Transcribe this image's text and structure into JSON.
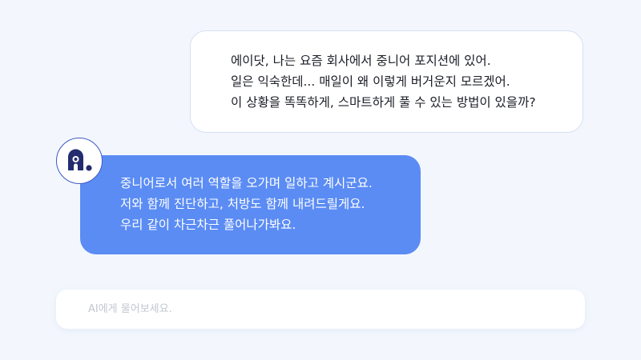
{
  "conversation": {
    "user_message": {
      "lines": [
        "에이닷, 나는 요즘 회사에서 중니어 포지션에 있어.",
        "일은 익숙한데... 매일이 왜 이렇게 버거운지 모르겠어.",
        "이 상황을 똑똑하게, 스마트하게 풀 수 있는 방법이 있을까?"
      ]
    },
    "assistant": {
      "avatar_icon": "assistant-logo-icon",
      "message": {
        "lines": [
          "중니어로서 여러 역할을 오가며 일하고 계시군요.",
          "저와 함께 진단하고, 처방도 함께 내려드릴게요.",
          "우리 같이 차근차근 풀어나가봐요."
        ]
      }
    }
  },
  "input": {
    "placeholder": "AI에게 물어보세요.",
    "value": ""
  },
  "colors": {
    "background": "#f3f7fd",
    "user_bubble": "#ffffff",
    "user_bubble_border": "#d4e0f3",
    "assistant_bubble": "#5b8cf4",
    "accent": "#3d58c9"
  }
}
